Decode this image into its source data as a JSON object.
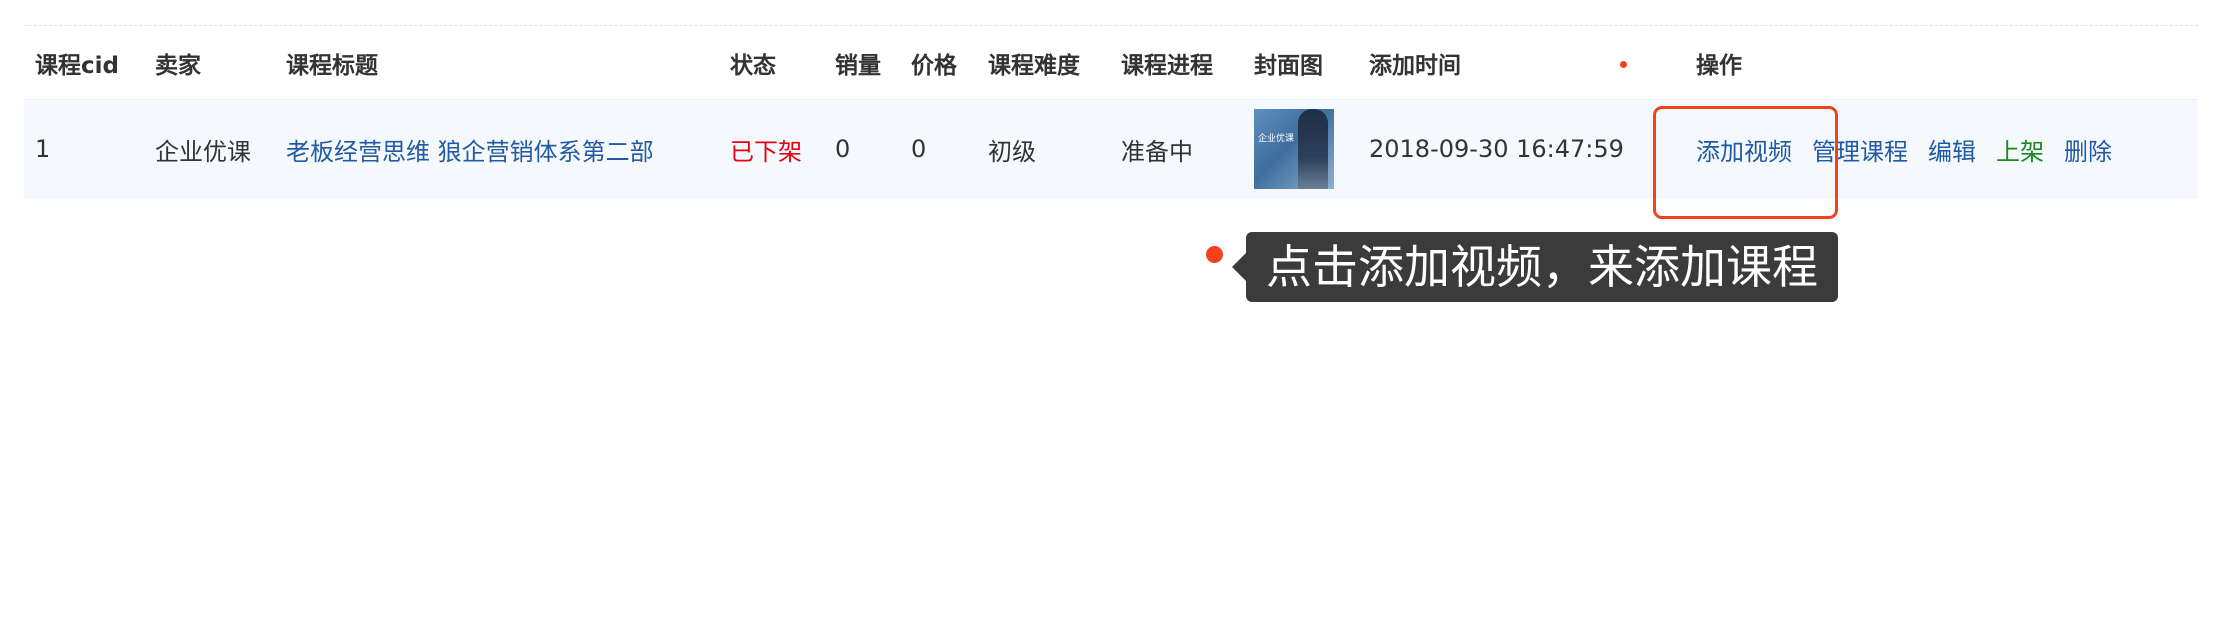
{
  "table": {
    "headers": {
      "cid": "课程cid",
      "seller": "卖家",
      "title": "课程标题",
      "status": "状态",
      "sales": "销量",
      "price": "价格",
      "difficulty": "课程难度",
      "progress": "课程进程",
      "cover": "封面图",
      "added_time": "添加时间",
      "actions": "操作"
    },
    "rows": [
      {
        "cid": "1",
        "seller": "企业优课",
        "title": "老板经营思维 狼企营销体系第二部",
        "status": "已下架",
        "sales": "0",
        "price": "0",
        "difficulty": "初级",
        "progress": "准备中",
        "cover_text": "企业优课",
        "added_time": "2018-09-30 16:47:59",
        "actions": {
          "add_video": "添加视频",
          "manage_course": "管理课程",
          "edit": "编辑",
          "publish": "上架",
          "delete": "删除"
        }
      }
    ]
  },
  "annotation": {
    "tooltip": "点击添加视频，来添加课程"
  },
  "colors": {
    "link_blue": "#215aa3",
    "status_red": "#e60012",
    "publish_green": "#1c8a1c",
    "highlight_red": "#f2411f",
    "tooltip_bg": "#3b3b3b"
  }
}
